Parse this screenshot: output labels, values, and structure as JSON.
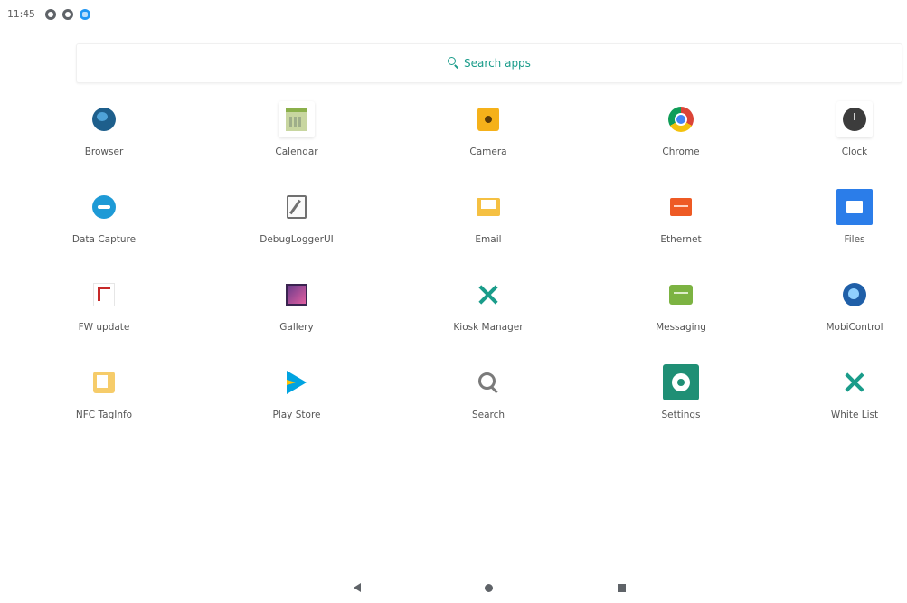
{
  "status_bar": {
    "time": "11:45",
    "icons": [
      "notification-icon",
      "notification-icon",
      "download-icon"
    ]
  },
  "search": {
    "label": "Search apps"
  },
  "apps": [
    {
      "label": "Browser",
      "icon": "browser-icon"
    },
    {
      "label": "Calendar",
      "icon": "calendar-icon"
    },
    {
      "label": "Camera",
      "icon": "camera-icon"
    },
    {
      "label": "Chrome",
      "icon": "chrome-icon"
    },
    {
      "label": "Clock",
      "icon": "clock-icon"
    },
    {
      "label": "Data Capture",
      "icon": "data-capture-icon"
    },
    {
      "label": "DebugLoggerUI",
      "icon": "debug-logger-icon"
    },
    {
      "label": "Email",
      "icon": "email-icon"
    },
    {
      "label": "Ethernet",
      "icon": "ethernet-icon"
    },
    {
      "label": "Files",
      "icon": "files-icon"
    },
    {
      "label": "FW update",
      "icon": "fw-update-icon"
    },
    {
      "label": "Gallery",
      "icon": "gallery-icon"
    },
    {
      "label": "Kiosk Manager",
      "icon": "kiosk-manager-icon"
    },
    {
      "label": "Messaging",
      "icon": "messaging-icon"
    },
    {
      "label": "MobiControl",
      "icon": "mobicontrol-icon"
    },
    {
      "label": "NFC TagInfo",
      "icon": "nfc-taginfo-icon"
    },
    {
      "label": "Play Store",
      "icon": "play-store-icon"
    },
    {
      "label": "Search",
      "icon": "search-icon"
    },
    {
      "label": "Settings",
      "icon": "settings-icon"
    },
    {
      "label": "White List",
      "icon": "white-list-icon"
    }
  ],
  "nav": {
    "buttons": [
      "back-icon",
      "home-icon",
      "recents-icon"
    ]
  },
  "colors": {
    "accent": "#1a9c8a",
    "text": "#555555",
    "background": "#ffffff"
  }
}
